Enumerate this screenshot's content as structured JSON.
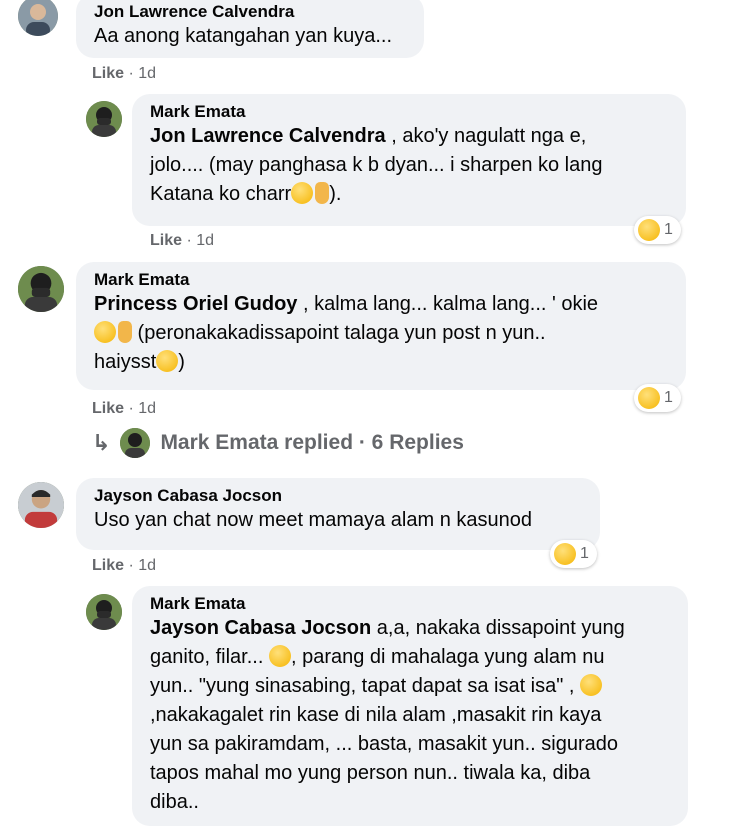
{
  "comments": [
    {
      "author": "Jon Lawrence Calvendra",
      "text": "Aa anong katangahan yan kuya...",
      "like": "Like",
      "time": "· 1d"
    },
    {
      "author": "Mark Emata",
      "mention": "Jon Lawrence Calvendra",
      "text_line1": " , ako'y nagulatt nga e,",
      "text_line2": "jolo.... (may panghasa k b dyan... i sharpen ko lang",
      "text_line3a": "Katana ko charr",
      "text_line3b": ").",
      "like": "Like",
      "time": "· 1d",
      "reaction_count": "1"
    },
    {
      "author": "Mark Emata",
      "mention": "Princess Oriel Gudoy",
      "text_line1": " , kalma lang... kalma lang... ' okie",
      "text_line2": " (peronakakadissapoint talaga yun post n yun..",
      "text_line3": "haiysst",
      "text_line3b": ")",
      "like": "Like",
      "time": "· 1d",
      "reaction_count": "1"
    },
    {
      "author": "Jayson Cabasa Jocson",
      "text": "Uso yan chat now meet mamaya alam n kasunod",
      "like": "Like",
      "time": "· 1d",
      "reaction_count": "1"
    },
    {
      "author": "Mark Emata",
      "mention": "Jayson Cabasa Jocson",
      "text_line1": " a,a, nakaka dissapoint yung",
      "text_line2a": "ganito, filar... ",
      "text_line2b": ", parang di mahalaga yung alam nu",
      "text_line3": "yun.. \"yung sinasabing, tapat dapat sa isat isa\" ,",
      "text_line4": ",nakakagalet rin kase di nila alam ,masakit rin kaya",
      "text_line5": "yun sa pakiramdam, ... basta, masakit yun.. sigurado",
      "text_line6": "tapos mahal mo yung person nun.. tiwala ka, diba",
      "text_line7": "diba.."
    }
  ],
  "replies_link": {
    "text": "Mark Emata replied · 6 Replies"
  },
  "icons": {
    "reply_arrow": "reply-arrow-icon",
    "haha": "haha-reaction-icon",
    "sad": "sad-reaction-icon"
  },
  "colors": {
    "bubble": "#f0f2f5",
    "meta": "#65676b",
    "text": "#050505"
  }
}
